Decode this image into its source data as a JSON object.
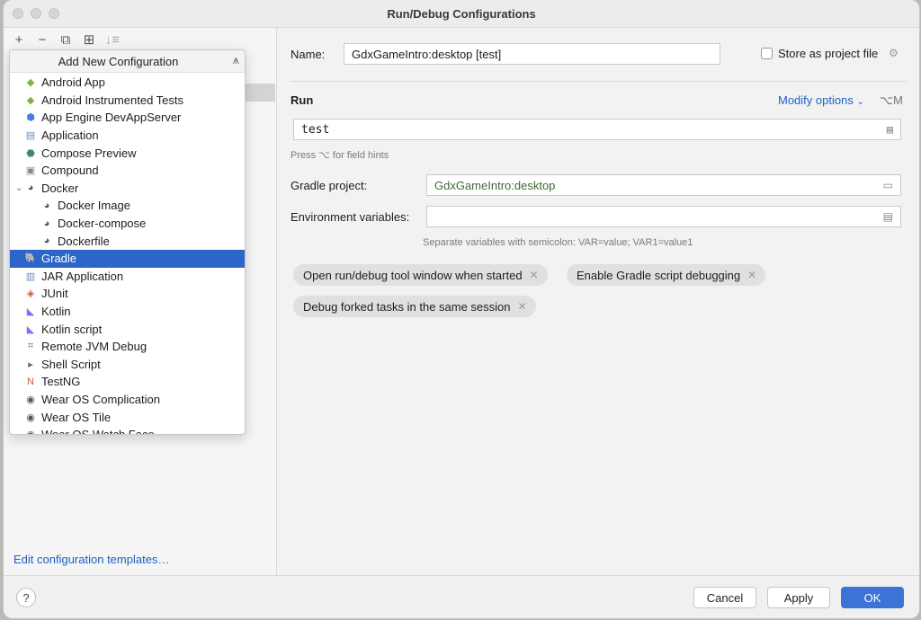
{
  "window": {
    "title": "Run/Debug Configurations"
  },
  "toolbar": {
    "add": "+",
    "remove": "−",
    "copy": "⧉",
    "folder": "⊞",
    "sort": "↓≡"
  },
  "popup": {
    "title": "Add New Configuration",
    "items": [
      {
        "label": "Android App",
        "icon": "android-icon",
        "color": "#7cb342",
        "glyph": "◆"
      },
      {
        "label": "Android Instrumented Tests",
        "icon": "android-test-icon",
        "color": "#7cb342",
        "glyph": "◆"
      },
      {
        "label": "App Engine DevAppServer",
        "icon": "app-engine-icon",
        "color": "#4a7fe0",
        "glyph": "⬢"
      },
      {
        "label": "Application",
        "icon": "application-icon",
        "color": "#6a8fbf",
        "glyph": "▤"
      },
      {
        "label": "Compose Preview",
        "icon": "compose-icon",
        "color": "#3d8b6a",
        "glyph": "⬣"
      },
      {
        "label": "Compound",
        "icon": "compound-icon",
        "color": "#888888",
        "glyph": "▣"
      },
      {
        "label": "Docker",
        "icon": "docker-icon",
        "color": "#555555",
        "glyph": "◕",
        "expanded": "⌄"
      },
      {
        "label": "Docker Image",
        "icon": "docker-image-icon",
        "color": "#555555",
        "glyph": "◕",
        "indent": true
      },
      {
        "label": "Docker-compose",
        "icon": "docker-compose-icon",
        "color": "#555555",
        "glyph": "◕",
        "indent": true
      },
      {
        "label": "Dockerfile",
        "icon": "dockerfile-icon",
        "color": "#555555",
        "glyph": "◕",
        "indent": true
      },
      {
        "label": "Gradle",
        "icon": "gradle-icon",
        "color": "#ffffff",
        "glyph": "🐘",
        "selected": true
      },
      {
        "label": "JAR Application",
        "icon": "jar-icon",
        "color": "#6a8fbf",
        "glyph": "▥"
      },
      {
        "label": "JUnit",
        "icon": "junit-icon",
        "color": "#d35a3a",
        "glyph": "◈"
      },
      {
        "label": "Kotlin",
        "icon": "kotlin-icon",
        "color": "#8b6cf0",
        "glyph": "◣"
      },
      {
        "label": "Kotlin script",
        "icon": "kotlin-script-icon",
        "color": "#8b6cf0",
        "glyph": "◣"
      },
      {
        "label": "Remote JVM Debug",
        "icon": "remote-debug-icon",
        "color": "#666666",
        "glyph": "⌗"
      },
      {
        "label": "Shell Script",
        "icon": "shell-icon",
        "color": "#666666",
        "glyph": "▸"
      },
      {
        "label": "TestNG",
        "icon": "testng-icon",
        "color": "#d35a3a",
        "glyph": "N"
      },
      {
        "label": "Wear OS Complication",
        "icon": "wear-os-complication-icon",
        "color": "#555555",
        "glyph": "◉"
      },
      {
        "label": "Wear OS Tile",
        "icon": "wear-os-tile-icon",
        "color": "#555555",
        "glyph": "◉"
      },
      {
        "label": "Wear OS Watch Face",
        "icon": "wear-os-watch-face-icon",
        "color": "#555555",
        "glyph": "◉"
      }
    ]
  },
  "left": {
    "edit_templates": "Edit configuration templates…"
  },
  "form": {
    "name_label": "Name:",
    "name_value": "GdxGameIntro:desktop [test]",
    "store_label": "Store as project file",
    "run_heading": "Run",
    "modify_options": "Modify options",
    "modify_shortcut": "⌥M",
    "run_value": "test",
    "field_hint": "Press ⌥ for field hints",
    "gradle_project_label": "Gradle project:",
    "gradle_project_value": "GdxGameIntro:desktop",
    "env_label": "Environment variables:",
    "env_value": "",
    "env_hint": "Separate variables with semicolon: VAR=value; VAR1=value1",
    "chips": [
      "Open run/debug tool window when started",
      "Enable Gradle script debugging",
      "Debug forked tasks in the same session"
    ]
  },
  "footer": {
    "help": "?",
    "cancel": "Cancel",
    "apply": "Apply",
    "ok": "OK"
  },
  "colors": {
    "accent": "#2c66c8",
    "link": "#2160c4",
    "gradle_value": "#3d6b35"
  }
}
